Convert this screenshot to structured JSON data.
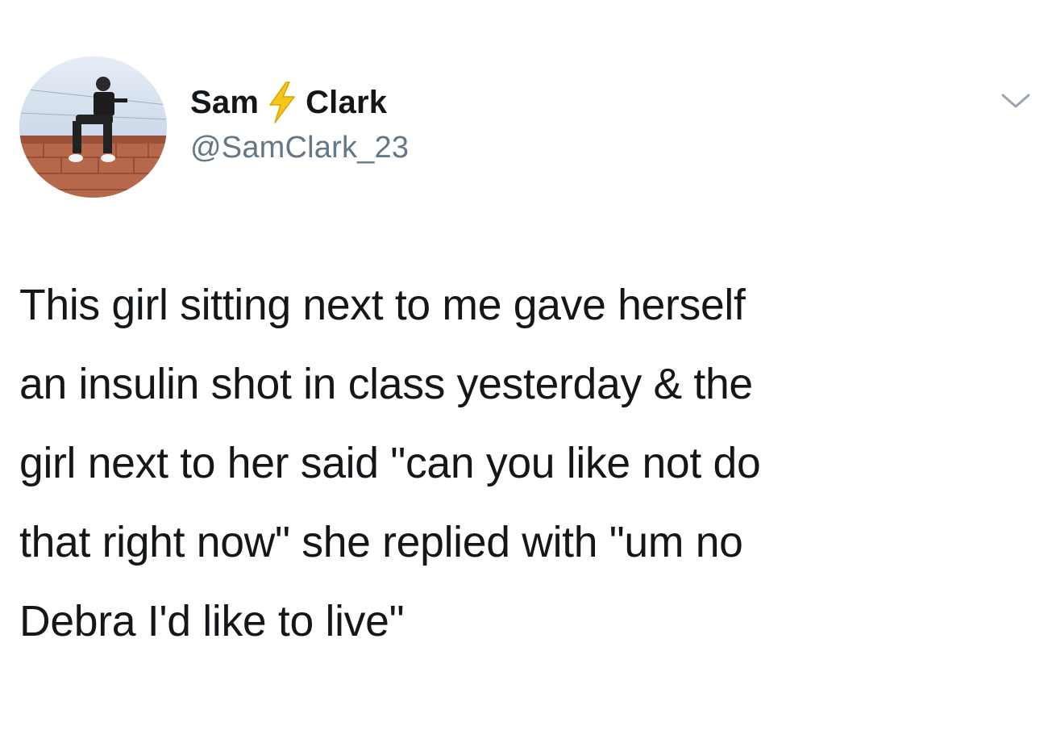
{
  "tweet": {
    "display_name_first": "Sam",
    "display_name_last": "Clark",
    "name_emoji_icon": "high-voltage-icon",
    "handle": "@SamClark_23",
    "text_lines": [
      "This girl sitting next to me gave herself",
      "an insulin shot in class yesterday & the",
      "girl next to her said \"can you like not do",
      "that right now\" she replied with \"um no",
      "Debra I'd like to live\""
    ]
  },
  "colors": {
    "background": "#ffffff",
    "text": "#14171a",
    "secondary_text": "#657786",
    "bolt": "#f5c518"
  }
}
